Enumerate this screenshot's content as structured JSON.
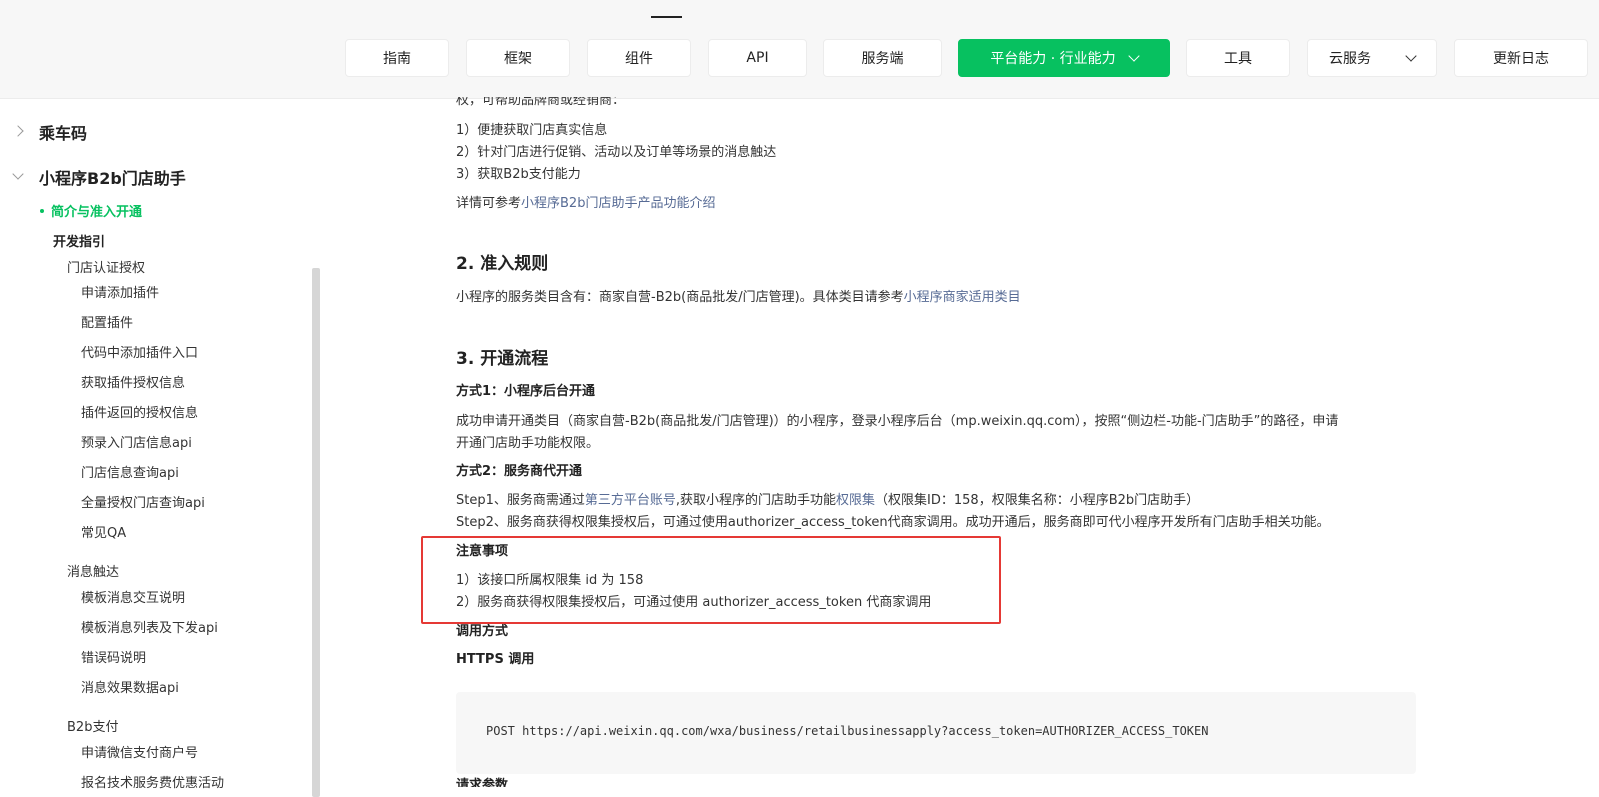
{
  "nav": {
    "items": [
      {
        "label": "指南",
        "active": false
      },
      {
        "label": "框架",
        "active": false
      },
      {
        "label": "组件",
        "active": false
      },
      {
        "label": "API",
        "active": false
      },
      {
        "label": "服务端",
        "active": false
      },
      {
        "label": "平台能力 · 行业能力",
        "active": true,
        "has_dropdown": true
      },
      {
        "label": "工具",
        "active": false
      },
      {
        "label": "云服务",
        "active": false,
        "has_dropdown": true
      },
      {
        "label": "更新日志",
        "active": false
      }
    ],
    "active_color": "#07c160"
  },
  "sidebar": {
    "collapsed_section": "乘车码",
    "expanded_section": "小程序B2b门店助手",
    "active_item": "简介与准入开通",
    "dev_guide": "开发指引",
    "groups": [
      {
        "label": "门店认证授权",
        "items": [
          "申请添加插件",
          "配置插件",
          "代码中添加插件入口",
          "获取插件授权信息",
          "插件返回的授权信息",
          "预录入门店信息api",
          "门店信息查询api",
          "全量授权门店查询api",
          "常见QA"
        ]
      },
      {
        "label": "消息触达",
        "items": [
          "模板消息交互说明",
          "模板消息列表及下发api",
          "错误码说明",
          "消息效果数据api"
        ]
      },
      {
        "label": "B2b支付",
        "items": [
          "申请微信支付商户号",
          "报名技术服务费优惠活动"
        ]
      }
    ]
  },
  "main": {
    "intro_cut": "权，可帮助品牌商或经销商：",
    "benefits": [
      "1）便捷获取门店真实信息",
      "2）针对门店进行促销、活动以及订单等场景的消息触达",
      "3）获取B2b支付能力"
    ],
    "detail_prefix": "详情可参考",
    "detail_link": "小程序B2b门店助手产品功能介绍",
    "section2_title": "2. 准入规则",
    "section2_text": "小程序的服务类目含有：商家自营-B2b(商品批发/门店管理)。具体类目请参考",
    "section2_link": "小程序商家适用类目",
    "section3_title": "3. 开通流程",
    "method1_title": "方式1：小程序后台开通",
    "method1_line1": "成功申请开通类目（商家自营-B2b(商品批发/门店管理)）的小程序，登录小程序后台（mp.weixin.qq.com），按照“侧边栏-功能-门店助手”的路径，申请",
    "method1_line2": "开通门店助手功能权限。",
    "method2_title": "方式2：服务商代开通",
    "step1_a": "Step1、服务商需通过",
    "step1_link1": "第三方平台账号",
    "step1_b": ",获取小程序的门店助手功能",
    "step1_link2": "权限集",
    "step1_c": "（权限集ID：158，权限集名称：小程序B2b门店助手）",
    "step2": "Step2、服务商获得权限集授权后，可通过使用authorizer_access_token代商家调用。成功开通后，服务商即可代小程序开发所有门店助手相关功能。",
    "notice_title": "注意事项",
    "notice_1": "1）该接口所属权限集 id 为 158",
    "notice_2": "2）服务商获得权限集授权后，可通过使用 authorizer_access_token 代商家调用",
    "call_title": "调用方式",
    "https_title": "HTTPS 调用",
    "code": "POST https://api.weixin.qq.com/wxa/business/retailbusinessapply?access_token=AUTHORIZER_ACCESS_TOKEN",
    "next_title_cut": "请求参数"
  }
}
